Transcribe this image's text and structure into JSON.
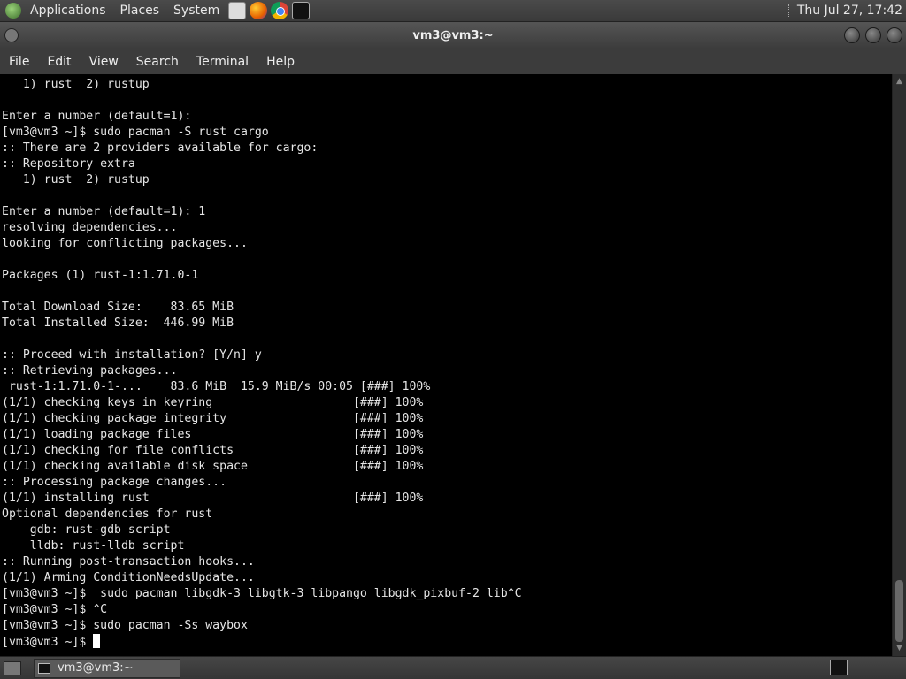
{
  "top_panel": {
    "menus": [
      "Applications",
      "Places",
      "System"
    ],
    "launchers": [
      "files-icon",
      "firefox-icon",
      "chrome-icon",
      "terminal-icon"
    ],
    "clock": "Thu Jul 27, 17:42"
  },
  "window": {
    "title": "vm3@vm3:~",
    "menu": [
      "File",
      "Edit",
      "View",
      "Search",
      "Terminal",
      "Help"
    ]
  },
  "terminal": {
    "lines": [
      "   1) rust  2) rustup",
      "",
      "Enter a number (default=1):",
      "[vm3@vm3 ~]$ sudo pacman -S rust cargo",
      ":: There are 2 providers available for cargo:",
      ":: Repository extra",
      "   1) rust  2) rustup",
      "",
      "Enter a number (default=1): 1",
      "resolving dependencies...",
      "looking for conflicting packages...",
      "",
      "Packages (1) rust-1:1.71.0-1",
      "",
      "Total Download Size:    83.65 MiB",
      "Total Installed Size:  446.99 MiB",
      "",
      ":: Proceed with installation? [Y/n] y",
      ":: Retrieving packages...",
      " rust-1:1.71.0-1-...    83.6 MiB  15.9 MiB/s 00:05 [###] 100%",
      "(1/1) checking keys in keyring                    [###] 100%",
      "(1/1) checking package integrity                  [###] 100%",
      "(1/1) loading package files                       [###] 100%",
      "(1/1) checking for file conflicts                 [###] 100%",
      "(1/1) checking available disk space               [###] 100%",
      ":: Processing package changes...",
      "(1/1) installing rust                             [###] 100%",
      "Optional dependencies for rust",
      "    gdb: rust-gdb script",
      "    lldb: rust-lldb script",
      ":: Running post-transaction hooks...",
      "(1/1) Arming ConditionNeedsUpdate...",
      "[vm3@vm3 ~]$  sudo pacman libgdk-3 libgtk-3 libpango libgdk_pixbuf-2 lib^C",
      "[vm3@vm3 ~]$ ^C",
      "[vm3@vm3 ~]$ sudo pacman -Ss waybox"
    ],
    "prompt": "[vm3@vm3 ~]$ "
  },
  "taskbar": {
    "task_label": "vm3@vm3:~"
  }
}
